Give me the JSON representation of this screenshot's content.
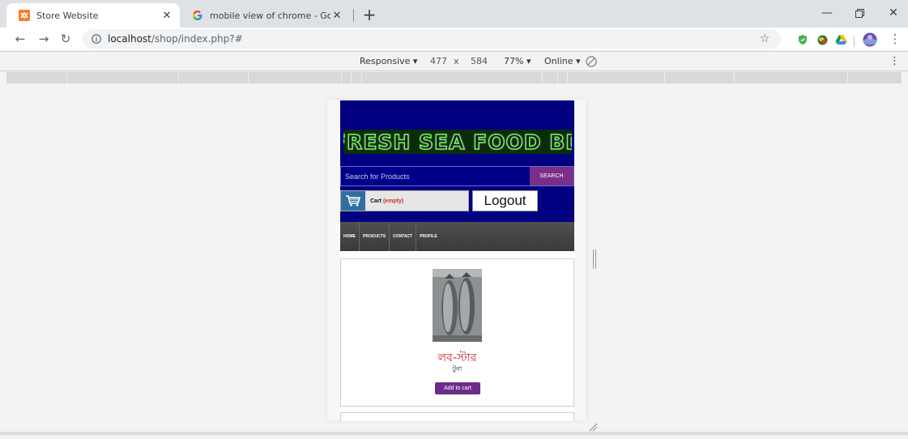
{
  "tabs": [
    {
      "title": "Store Website",
      "active": true,
      "icon": "xampp-icon"
    },
    {
      "title": "mobile view of chrome - Google",
      "active": false,
      "icon": "google-g-icon"
    }
  ],
  "omnibox": {
    "host": "localhost",
    "path": "/shop/index.php?#"
  },
  "device_toolbar": {
    "device": "Responsive",
    "width": "477",
    "times": "x",
    "height": "584",
    "zoom": "77%",
    "network": "Online"
  },
  "site": {
    "logo_text": "FRESH SEA FOOD BD",
    "search_placeholder": "Search for Products",
    "search_button": "SEARCH",
    "cart_label": "Cart",
    "cart_status": "(empty)",
    "logout": "Logout",
    "nav": [
      "HOME",
      "PRODUCTS",
      "CONTACT",
      "PROFILE"
    ],
    "product": {
      "name": "লব-স্টার",
      "price": "টুনা",
      "add_to_cart": "Add to cart"
    }
  },
  "colors": {
    "header_bg": "#000080",
    "logo_stroke": "#7cf06e",
    "search_button_bg": "#7b2e88",
    "add_to_cart_bg": "#6e2d8b",
    "product_name": "#c02c2c"
  }
}
